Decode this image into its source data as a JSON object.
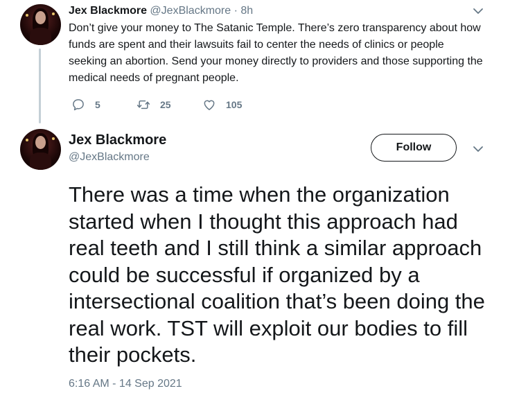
{
  "tweet1": {
    "author_name": "Jex Blackmore",
    "author_handle": "@JexBlackmore",
    "separator": "·",
    "time": "8h",
    "text": "Don’t give your money to The Satanic Temple. There’s zero transparency about how funds are spent and their lawsuits fail to center the needs of clinics or people seeking an abortion. Send your money directly to providers and those supporting the medical needs of pregnant people.",
    "replies": "5",
    "retweets": "25",
    "likes": "105",
    "icons": {
      "reply": "reply-icon",
      "retweet": "retweet-icon",
      "like": "heart-icon",
      "menu": "chevron-down-icon"
    }
  },
  "tweet2": {
    "author_name": "Jex Blackmore",
    "author_handle": "@JexBlackmore",
    "follow_label": "Follow",
    "text": "There was a time when the organization started when I thought this approach had real teeth and I still think a similar approach could be successful if organized by a intersectional coalition that’s been doing the real work. TST will exploit our bodies to fill their pockets.",
    "timestamp": "6:16 AM - 14 Sep 2021"
  },
  "colors": {
    "text": "#14171a",
    "secondary": "#657786",
    "thread_line": "#c4cfd6"
  }
}
